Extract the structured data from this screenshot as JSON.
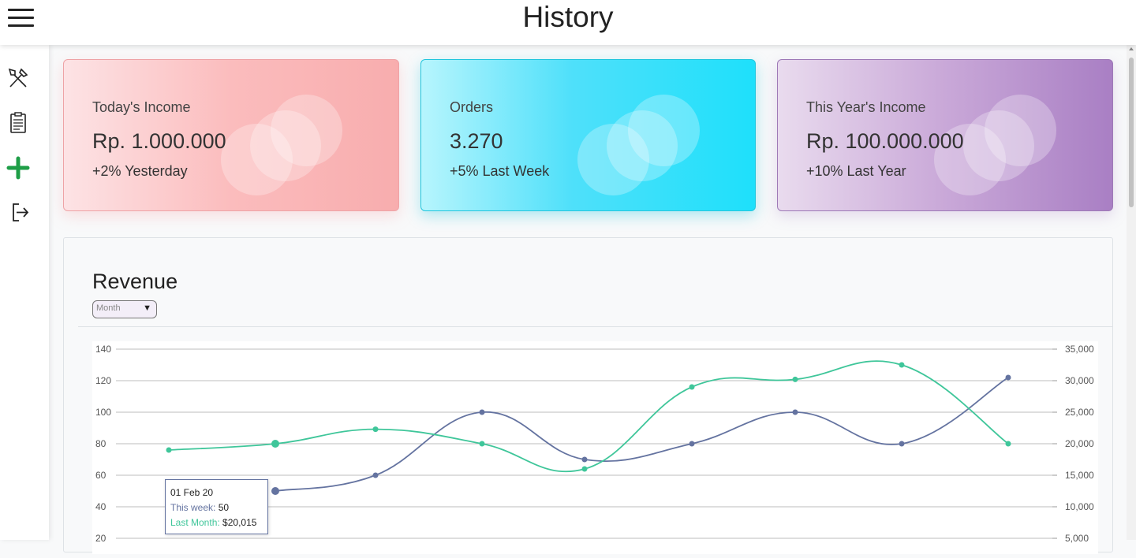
{
  "header": {
    "title": "History",
    "menu_icon": "hamburger-menu-icon"
  },
  "sidebar": {
    "items": [
      {
        "icon": "utensils-icon",
        "name": "sidebar-item-menu"
      },
      {
        "icon": "report-icon",
        "name": "sidebar-item-reports"
      },
      {
        "icon": "add-icon",
        "name": "sidebar-item-add",
        "color": "#1e9e47"
      },
      {
        "icon": "logout-icon",
        "name": "sidebar-item-logout"
      }
    ]
  },
  "cards": [
    {
      "label": "Today's Income",
      "value": "Rp. 1.000.000",
      "sub": "+2% Yesterday"
    },
    {
      "label": "Orders",
      "value": "3.270",
      "sub": "+5% Last Week"
    },
    {
      "label": "This Year's Income",
      "value": "Rp. 100.000.000",
      "sub": "+10% Last Year"
    }
  ],
  "revenue": {
    "title": "Revenue",
    "period_select": {
      "selected": "Month"
    }
  },
  "tooltip": {
    "date": "01 Feb 20",
    "series_a_label": "This week:",
    "series_a_value": "50",
    "series_b_label": "Last Month:",
    "series_b_value": "$20,015"
  },
  "colors": {
    "series_a": "#6473a0",
    "series_b": "#3fc69a"
  },
  "chart_data": {
    "type": "line",
    "x_count": 9,
    "y_left": {
      "ticks": [
        "140",
        "120",
        "100",
        "80",
        "60",
        "40",
        "20"
      ],
      "ylim": [
        20,
        140
      ]
    },
    "y_right": {
      "ticks": [
        "35,000",
        "30,000",
        "25,000",
        "20,000",
        "15,000",
        "10,000",
        "5,000"
      ],
      "ylim": [
        5000,
        35000
      ]
    },
    "grid": true,
    "series": [
      {
        "axis": "left",
        "values": [
          null,
          50,
          60,
          100,
          70,
          80,
          100,
          80,
          122
        ]
      },
      {
        "axis": "right",
        "values": [
          19000,
          20000,
          22300,
          20000,
          16000,
          29000,
          30200,
          32500,
          20000
        ]
      }
    ]
  }
}
